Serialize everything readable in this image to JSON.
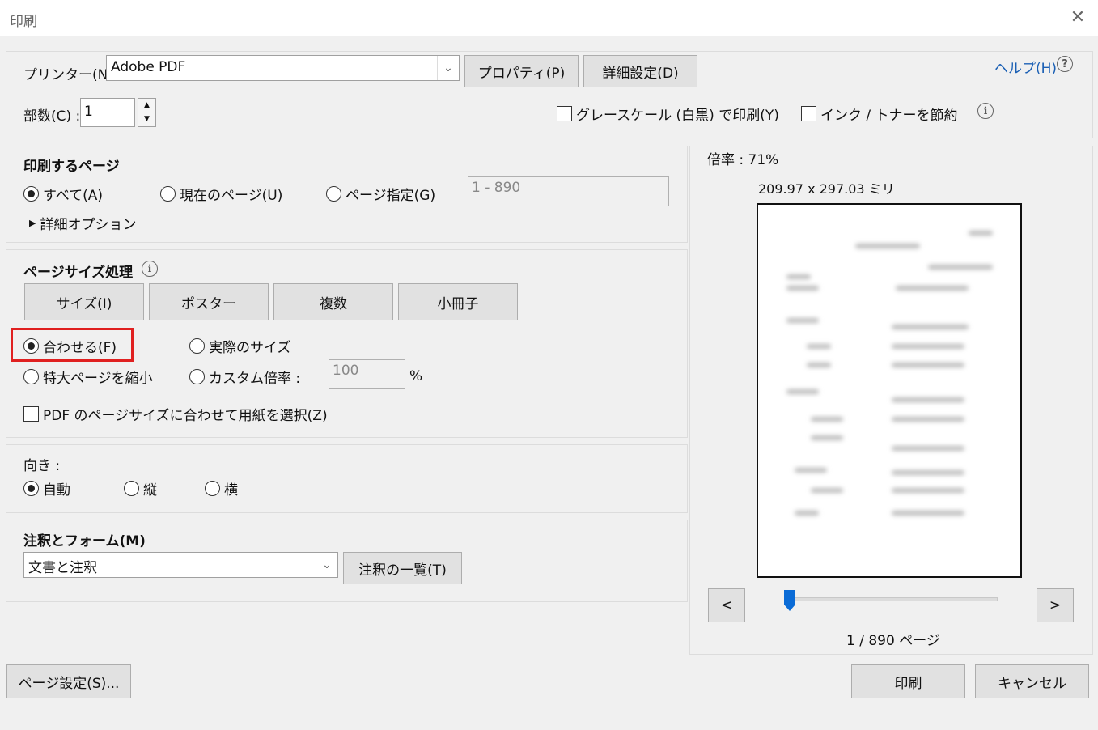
{
  "window": {
    "title": "印刷"
  },
  "printer": {
    "label": "プリンター(N) :",
    "selected": "Adobe PDF",
    "properties_button": "プロパティ(P)",
    "advanced_button": "詳細設定(D)",
    "help_link": "ヘルプ(H)"
  },
  "copies": {
    "label": "部数(C) :",
    "value": "1"
  },
  "options": {
    "grayscale": "グレースケール (白黒) で印刷(Y)",
    "save_ink": "インク / トナーを節約"
  },
  "pages": {
    "heading": "印刷するページ",
    "all": "すべて(A)",
    "current": "現在のページ(U)",
    "range": "ページ指定(G)",
    "range_value": "1 - 890",
    "more_options": "詳細オプション"
  },
  "sizing": {
    "heading": "ページサイズ処理",
    "tabs": [
      "サイズ(I)",
      "ポスター",
      "複数",
      "小冊子"
    ],
    "fit": "合わせる(F)",
    "actual": "実際のサイズ",
    "shrink": "特大ページを縮小",
    "custom": "カスタム倍率 :",
    "custom_value": "100",
    "percent": "%",
    "choose_paper": "PDF のページサイズに合わせて用紙を選択(Z)"
  },
  "orientation": {
    "heading": "向き :",
    "auto": "自動",
    "portrait": "縦",
    "landscape": "横"
  },
  "comments": {
    "heading": "注釈とフォーム(M)",
    "selected": "文書と注釈",
    "summarize_button": "注釈の一覧(T)"
  },
  "preview": {
    "scale": "倍率 :  71%",
    "dimensions": "209.97 x 297.03 ミリ",
    "prev": "<",
    "next": ">",
    "page_indicator": "1 / 890 ページ",
    "slider_fraction": 0
  },
  "footer": {
    "page_setup": "ページ設定(S)...",
    "print": "印刷",
    "cancel": "キャンセル"
  },
  "colors": {
    "highlight": "#e02020",
    "slider": "#0a6bd6"
  },
  "icons": [
    "close-icon",
    "help-icon",
    "info-icon",
    "chevron-down-icon",
    "triangle-right-icon"
  ]
}
